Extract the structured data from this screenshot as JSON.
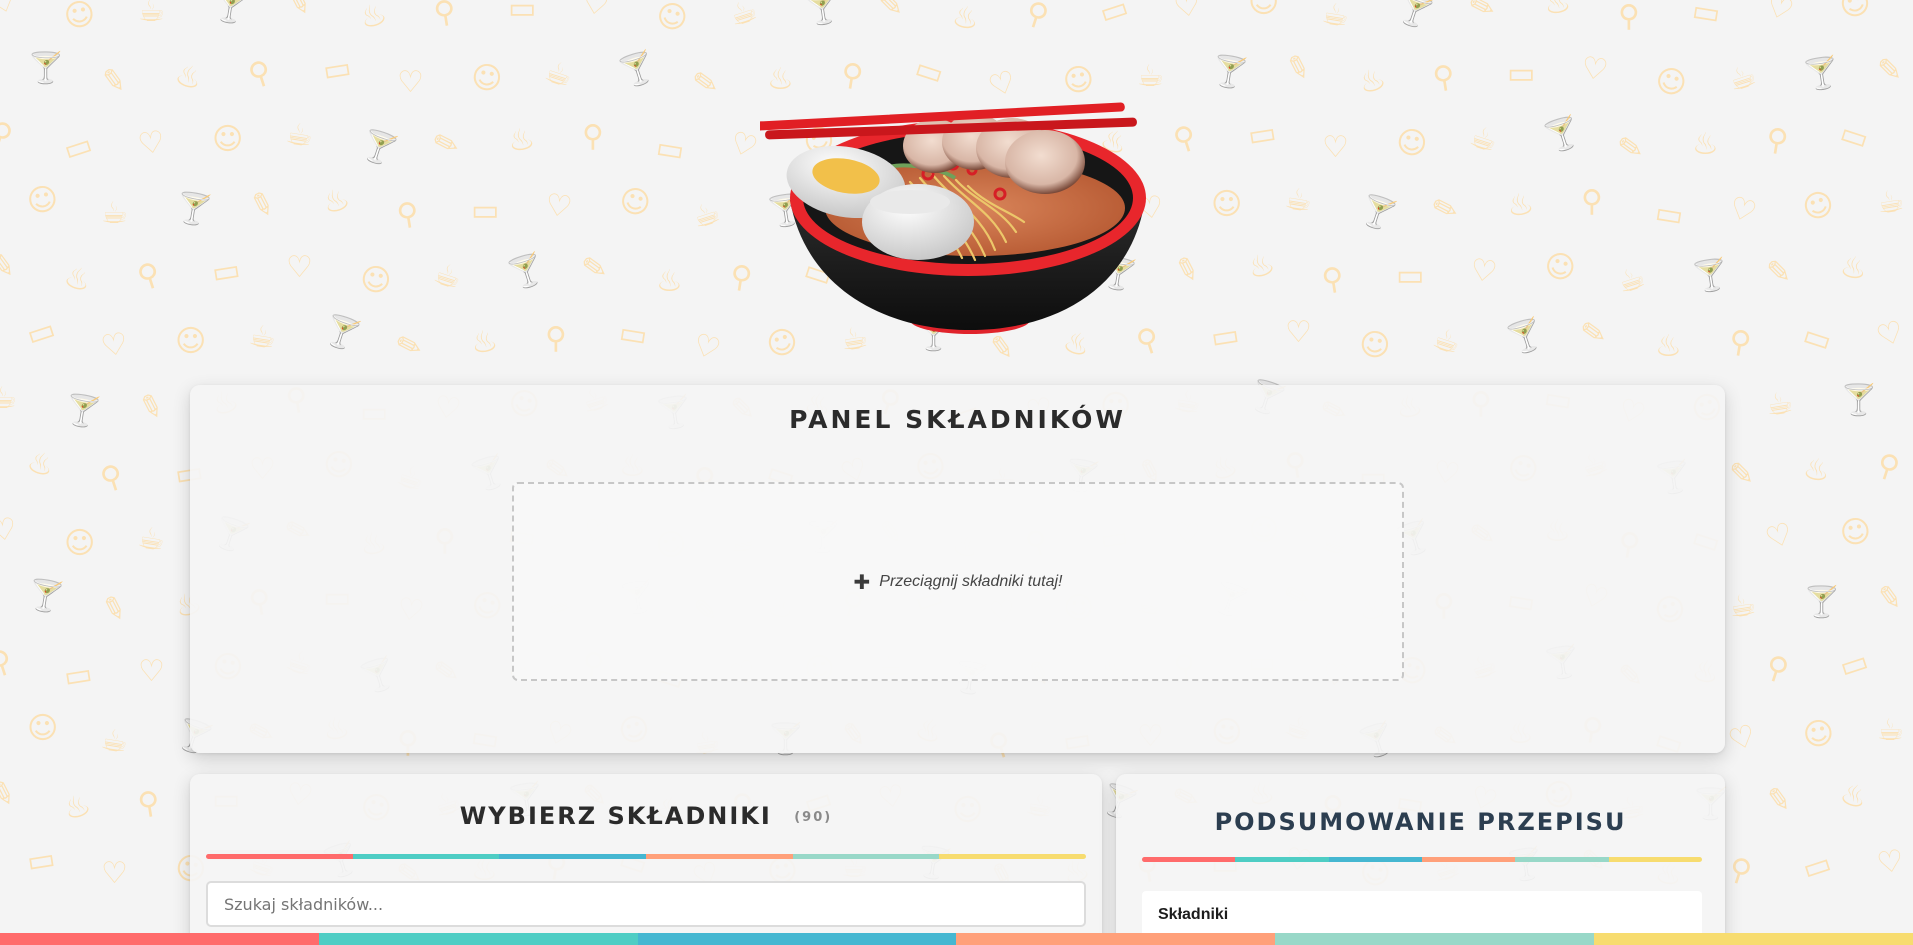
{
  "hero": {
    "image": "ramen-bowl-illustration"
  },
  "ingredient_panel": {
    "title": "PANEL SKŁADNIKÓW",
    "dropzone_icon": "plus-icon",
    "dropzone_label": "Przeciągnij składniki tutaj!"
  },
  "ingredient_picker": {
    "title": "WYBIERZ SKŁADNIKI",
    "count": "(90)",
    "search_placeholder": "Szukaj składników..."
  },
  "recipe_summary": {
    "title": "PODSUMOWANIE PRZEPISU",
    "section_label": "Składniki"
  },
  "colors": {
    "stripe": [
      "#ff6b6b",
      "#4ecdc4",
      "#45b7d1",
      "#ffa07a",
      "#98d8c8",
      "#f7dc6f"
    ],
    "pattern": "#fbe1b4",
    "summary_title": "#2c3e50"
  }
}
